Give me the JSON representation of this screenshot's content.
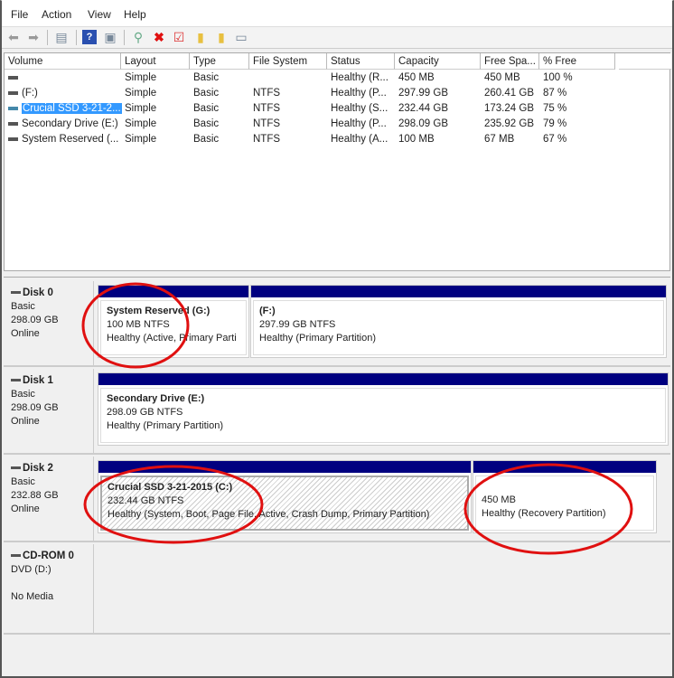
{
  "menu": [
    "File",
    "Action",
    "View",
    "Help"
  ],
  "toolbar": [
    "back-icon",
    "forward-icon",
    "console-tree-icon",
    "help-icon",
    "properties-pane-icon",
    "connect-icon",
    "delete-icon",
    "check-icon",
    "folder-up-icon",
    "search-folder-icon",
    "list-view-icon"
  ],
  "columns": [
    "Volume",
    "Layout",
    "Type",
    "File System",
    "Status",
    "Capacity",
    "Free Spa...",
    "% Free"
  ],
  "volumes": [
    {
      "volume": "",
      "layout": "Simple",
      "type": "Basic",
      "fs": "",
      "status": "Healthy (R...",
      "capacity": "450 MB",
      "free": "450 MB",
      "pct": "100 %"
    },
    {
      "volume": "(F:)",
      "layout": "Simple",
      "type": "Basic",
      "fs": "NTFS",
      "status": "Healthy (P...",
      "capacity": "297.99 GB",
      "free": "260.41 GB",
      "pct": "87 %"
    },
    {
      "volume": "Crucial SSD 3-21-2...",
      "layout": "Simple",
      "type": "Basic",
      "fs": "NTFS",
      "status": "Healthy (S...",
      "capacity": "232.44 GB",
      "free": "173.24 GB",
      "pct": "75 %",
      "selected": true
    },
    {
      "volume": "Secondary Drive (E:)",
      "layout": "Simple",
      "type": "Basic",
      "fs": "NTFS",
      "status": "Healthy (P...",
      "capacity": "298.09 GB",
      "free": "235.92 GB",
      "pct": "79 %"
    },
    {
      "volume": "System Reserved (...",
      "layout": "Simple",
      "type": "Basic",
      "fs": "NTFS",
      "status": "Healthy (A...",
      "capacity": "100 MB",
      "free": "67 MB",
      "pct": "67 %"
    }
  ],
  "disks": [
    {
      "name": "Disk 0",
      "type": "Basic",
      "size": "298.09 GB",
      "state": "Online",
      "partitions": [
        {
          "title": "System Reserved  (G:)",
          "size": "100 MB NTFS",
          "status": "Healthy (Active, Primary Parti"
        },
        {
          "title": " (F:)",
          "size": "297.99 GB NTFS",
          "status": "Healthy (Primary Partition)"
        }
      ]
    },
    {
      "name": "Disk 1",
      "type": "Basic",
      "size": "298.09 GB",
      "state": "Online",
      "partitions": [
        {
          "title": "Secondary Drive  (E:)",
          "size": "298.09 GB NTFS",
          "status": "Healthy (Primary Partition)"
        }
      ]
    },
    {
      "name": "Disk 2",
      "type": "Basic",
      "size": "232.88 GB",
      "state": "Online",
      "partitions": [
        {
          "title": "Crucial SSD 3-21-2015  (C:)",
          "size": "232.44 GB NTFS",
          "status": "Healthy (System, Boot, Page File, Active, Crash Dump, Primary Partition)"
        },
        {
          "title": "",
          "size": "450 MB",
          "status": "Healthy (Recovery Partition)"
        }
      ]
    },
    {
      "name": "CD-ROM 0",
      "type": "DVD (D:)",
      "size": "",
      "state": "No Media"
    }
  ],
  "colors": {
    "partition_bar": "#000080",
    "selection": "#3399ff",
    "annotation": "#e01010"
  }
}
